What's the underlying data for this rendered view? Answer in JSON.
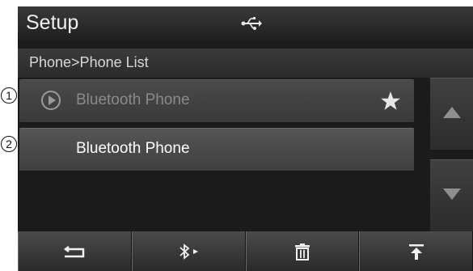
{
  "header": {
    "title": "Setup",
    "status_icon": "usb-icon"
  },
  "breadcrumb": "Phone>Phone List",
  "phone_list": {
    "items": [
      {
        "label": "Bluetooth Phone",
        "state": "disabled",
        "icons": [
          "play-icon",
          "star-icon"
        ]
      },
      {
        "label": "Bluetooth Phone",
        "state": "highlighted",
        "icons": []
      }
    ]
  },
  "scrollbar": {
    "up_icon": "arrow-up-icon",
    "down_icon": "arrow-down-icon"
  },
  "bottom_bar": {
    "buttons": [
      {
        "icon": "back-icon"
      },
      {
        "icon": "bluetooth-connect-icon"
      },
      {
        "icon": "trash-icon"
      },
      {
        "icon": "move-to-top-icon"
      }
    ]
  },
  "callouts": [
    "1",
    "2"
  ],
  "colors": {
    "screen_bg": "#1b1b1b",
    "item_disabled_text": "#8a8a8a",
    "item_text": "#ffffff"
  }
}
